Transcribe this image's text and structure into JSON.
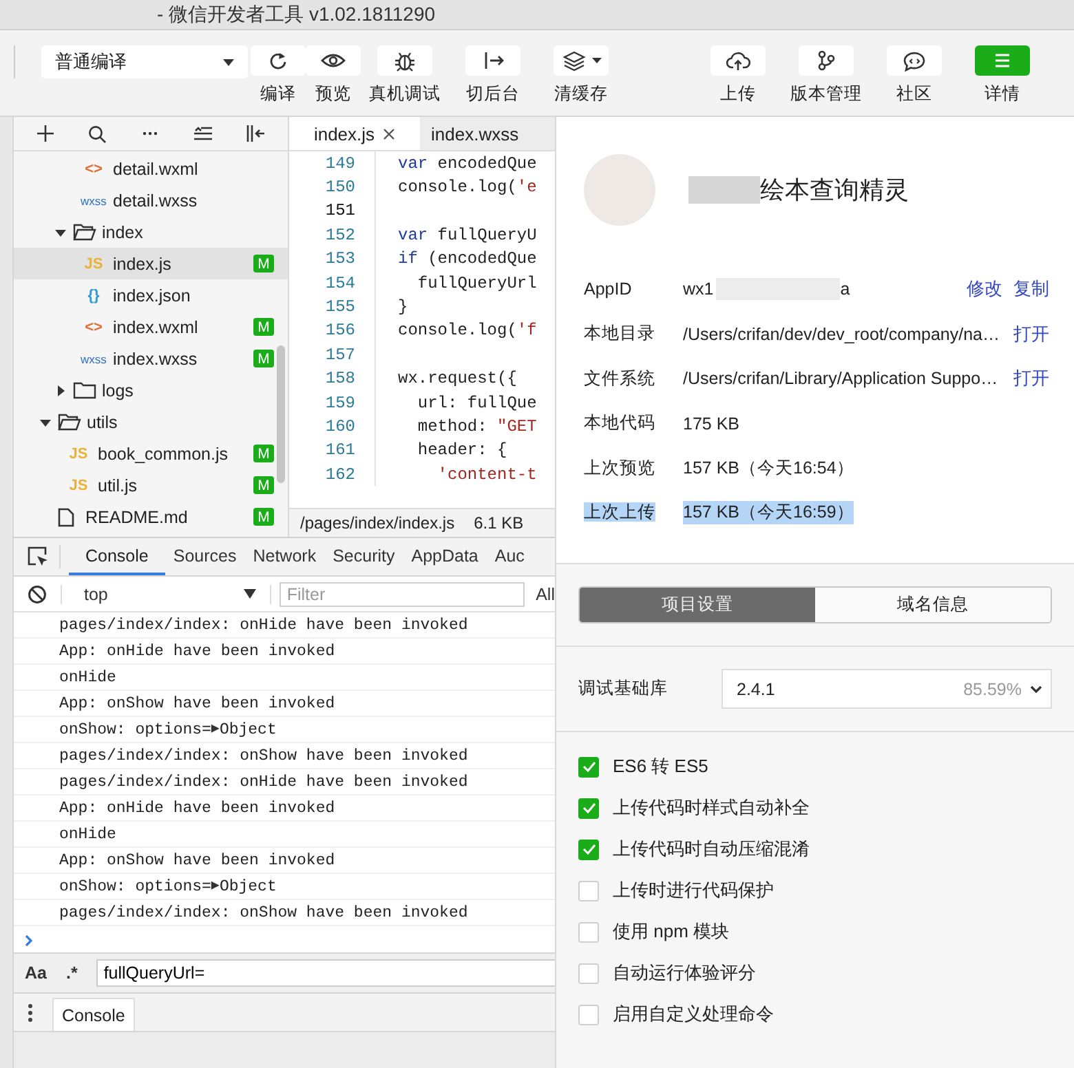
{
  "window": {
    "title": "- 微信开发者工具 v1.02.1811290"
  },
  "toolbar": {
    "compile_mode": "普通编译",
    "tools": [
      {
        "label": "编译",
        "kind": "refresh",
        "selected": false,
        "dropdown": false
      },
      {
        "label": "预览",
        "kind": "eye",
        "selected": false,
        "dropdown": false
      },
      {
        "label": "真机调试",
        "kind": "bug",
        "selected": false,
        "dropdown": false
      },
      {
        "label": "切后台",
        "kind": "exit",
        "selected": false,
        "dropdown": false
      },
      {
        "label": "清缓存",
        "kind": "layers",
        "selected": false,
        "dropdown": true
      },
      {
        "label": "上传",
        "kind": "upload",
        "selected": false,
        "dropdown": false
      },
      {
        "label": "版本管理",
        "kind": "branch",
        "selected": false,
        "dropdown": false
      },
      {
        "label": "社区",
        "kind": "chat",
        "selected": false,
        "dropdown": false
      },
      {
        "label": "详情",
        "kind": "menu",
        "selected": true,
        "dropdown": false
      }
    ]
  },
  "file_tree": {
    "items": [
      {
        "kind": "group",
        "children": [
          {
            "kind": "group",
            "children": [
              {
                "kind": "wxml",
                "glyph": "<>",
                "name": "detail.wxml",
                "selected": false
              },
              {
                "kind": "wxss",
                "glyph": "wxss",
                "name": "detail.wxss",
                "selected": false
              }
            ]
          },
          {
            "kind": "folder",
            "name": "index",
            "expanded": true,
            "children": [
              {
                "kind": "js",
                "glyph": "JS",
                "name": "index.js",
                "selected": true,
                "badge": "M"
              },
              {
                "kind": "json",
                "glyph": "{}",
                "name": "index.json",
                "selected": false
              },
              {
                "kind": "wxml",
                "glyph": "<>",
                "name": "index.wxml",
                "selected": false,
                "badge": "M"
              },
              {
                "kind": "wxss",
                "glyph": "wxss",
                "name": "index.wxss",
                "selected": false,
                "badge": "M"
              }
            ]
          },
          {
            "kind": "folder",
            "name": "logs",
            "expanded": false
          }
        ]
      },
      {
        "kind": "folder",
        "name": "utils",
        "expanded": true,
        "children": [
          {
            "kind": "js",
            "glyph": "JS",
            "name": "book_common.js",
            "selected": false,
            "badge": "M"
          },
          {
            "kind": "js",
            "glyph": "JS",
            "name": "util.js",
            "selected": false,
            "badge": "M"
          }
        ]
      },
      {
        "kind": "md",
        "name": "README.md",
        "selected": false,
        "badge": "M"
      }
    ]
  },
  "editor": {
    "tabs": [
      {
        "label": "index.js",
        "selected": true,
        "closable": true
      },
      {
        "label": "index.wxss",
        "selected": false,
        "closable": false
      }
    ],
    "lines": [
      {
        "number": "149",
        "current": false,
        "segments": [
          {
            "text": "var",
            "kind": "keyword"
          },
          {
            "text": " encodedQue",
            "kind": "plain"
          }
        ]
      },
      {
        "number": "150",
        "current": false,
        "segments": [
          {
            "text": "console.log(",
            "kind": "plain"
          },
          {
            "text": "'e",
            "kind": "string"
          }
        ]
      },
      {
        "number": "151",
        "current": true
      },
      {
        "number": "152",
        "current": false,
        "segments": [
          {
            "text": "var",
            "kind": "keyword"
          },
          {
            "text": " fullQueryU",
            "kind": "plain"
          }
        ]
      },
      {
        "number": "153",
        "current": false,
        "segments": [
          {
            "text": "if",
            "kind": "keyword"
          },
          {
            "text": " (encodedQue",
            "kind": "plain"
          }
        ]
      },
      {
        "number": "154",
        "current": false,
        "segments": [
          {
            "text": "  fullQueryUrl",
            "kind": "plain"
          }
        ]
      },
      {
        "number": "155",
        "current": false,
        "segments": [
          {
            "text": "}",
            "kind": "plain"
          }
        ]
      },
      {
        "number": "156",
        "current": false,
        "segments": [
          {
            "text": "console.log(",
            "kind": "plain"
          },
          {
            "text": "'f",
            "kind": "string"
          }
        ]
      },
      {
        "number": "157",
        "current": false
      },
      {
        "number": "158",
        "current": false,
        "segments": [
          {
            "text": "wx.request({",
            "kind": "plain"
          }
        ]
      },
      {
        "number": "159",
        "current": false,
        "segments": [
          {
            "text": "  url: fullQue",
            "kind": "plain"
          }
        ]
      },
      {
        "number": "160",
        "current": false,
        "segments": [
          {
            "text": "  method: ",
            "kind": "plain"
          },
          {
            "text": "\"GET",
            "kind": "string"
          }
        ]
      },
      {
        "number": "161",
        "current": false,
        "segments": [
          {
            "text": "  header: {",
            "kind": "plain"
          }
        ]
      },
      {
        "number": "162",
        "current": false,
        "segments": [
          {
            "text": "    'content-t",
            "kind": "string"
          }
        ]
      }
    ],
    "status": {
      "path": "/pages/index/index.js",
      "size": "6.1 KB"
    }
  },
  "console": {
    "tabs": [
      {
        "label": "Console",
        "selected": true
      },
      {
        "label": "Sources",
        "selected": false
      },
      {
        "label": "Network",
        "selected": false
      },
      {
        "label": "Security",
        "selected": false
      },
      {
        "label": "AppData",
        "selected": false
      },
      {
        "label": "Auc",
        "selected": false
      }
    ],
    "context": "top",
    "filter_placeholder": "Filter",
    "levels": "All",
    "logs": [
      {
        "kind": "text",
        "text": "pages/index/index: onHide have been invoked"
      },
      {
        "kind": "text",
        "text": "App: onHide have been invoked"
      },
      {
        "kind": "text",
        "text": "onHide"
      },
      {
        "kind": "text",
        "text": "App: onShow have been invoked"
      },
      {
        "kind": "object",
        "text": "onShow: options=",
        "arrow": "▶",
        "value": "Object"
      },
      {
        "kind": "text",
        "text": "pages/index/index: onShow have been invoked"
      },
      {
        "kind": "text",
        "text": "pages/index/index: onHide have been invoked"
      },
      {
        "kind": "text",
        "text": "App: onHide have been invoked"
      },
      {
        "kind": "text",
        "text": "onHide"
      },
      {
        "kind": "text",
        "text": "App: onShow have been invoked"
      },
      {
        "kind": "object",
        "text": "onShow: options=",
        "arrow": "▶",
        "value": "Object"
      },
      {
        "kind": "text",
        "text": "pages/index/index: onShow have been invoked"
      }
    ],
    "search": {
      "case_label": "Aa",
      "regex_label": ".*",
      "value": "fullQueryUrl="
    },
    "drawer_tabs": [
      {
        "label": "Console",
        "selected": true
      }
    ]
  },
  "details": {
    "app_name": "绘本查询精灵",
    "info": [
      {
        "kind": "masked",
        "label": "AppID",
        "value": "wx1",
        "value_end": "a",
        "links": [
          "修改",
          "复制"
        ],
        "highlighted": false
      },
      {
        "kind": "plain",
        "label": "本地目录",
        "value": "/Users/crifan/dev/dev_root/company/na…",
        "links": [
          "打开"
        ],
        "highlighted": false
      },
      {
        "kind": "plain",
        "label": "文件系统",
        "value": "/Users/crifan/Library/Application Suppo…",
        "links": [
          "打开"
        ],
        "highlighted": false
      },
      {
        "kind": "plain",
        "label": "本地代码",
        "value": "175 KB",
        "highlighted": false
      },
      {
        "kind": "plain",
        "label": "上次预览",
        "value": "157 KB（今天16:54）",
        "highlighted": false
      },
      {
        "kind": "plain",
        "label": "上次上传",
        "value": "157 KB（今天16:59）",
        "highlighted": true
      }
    ],
    "tabs": [
      {
        "label": "项目设置",
        "selected": true
      },
      {
        "label": "域名信息",
        "selected": false
      }
    ],
    "base_library": {
      "label": "调试基础库",
      "version": "2.4.1",
      "usage": "85.59%"
    },
    "options": [
      {
        "label": "ES6 转 ES5",
        "checked": true
      },
      {
        "label": "上传代码时样式自动补全",
        "checked": true
      },
      {
        "label": "上传代码时自动压缩混淆",
        "checked": true
      },
      {
        "label": "上传时进行代码保护",
        "checked": false
      },
      {
        "label": "使用 npm 模块",
        "checked": false
      },
      {
        "label": "自动运行体验评分",
        "checked": false
      },
      {
        "label": "启用自定义处理命令",
        "checked": false
      }
    ]
  }
}
